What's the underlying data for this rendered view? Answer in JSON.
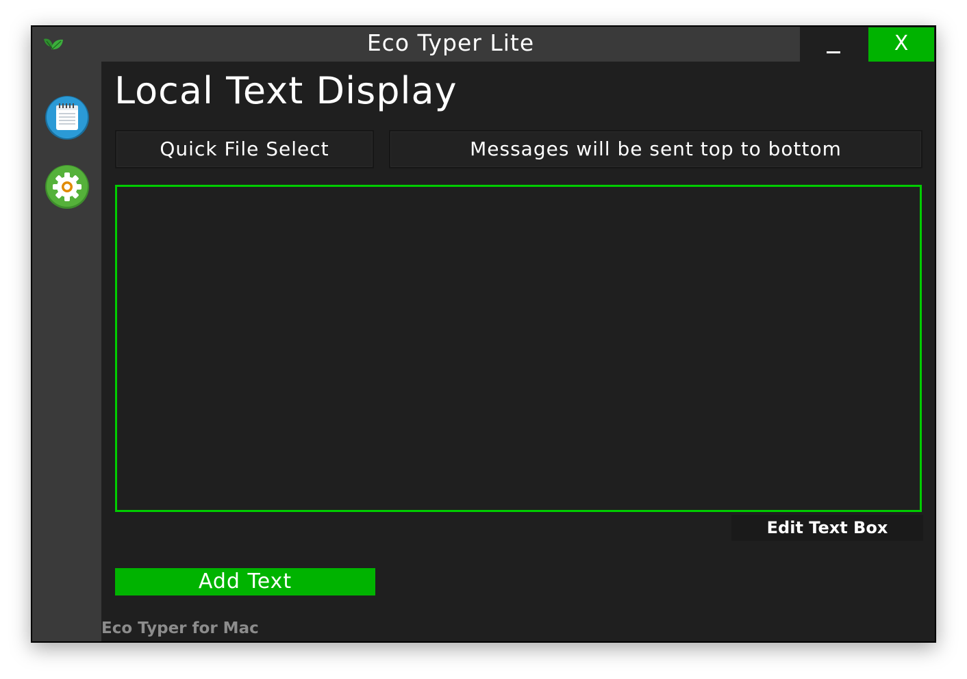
{
  "window": {
    "title": "Eco Typer Lite",
    "close_label": "X",
    "app_icon": "leaf-icon"
  },
  "sidebar": {
    "items": [
      {
        "name": "notepad",
        "icon": "notepad-icon"
      },
      {
        "name": "settings",
        "icon": "gear-icon"
      }
    ]
  },
  "main": {
    "heading": "Local Text Display",
    "quick_file_select_label": "Quick File Select",
    "order_message": "Messages will be sent top to bottom",
    "textbox_value": "",
    "edit_text_box_label": "Edit Text Box",
    "add_text_label": "Add Text"
  },
  "footer": {
    "text": "Eco Typer for Mac"
  },
  "colors": {
    "accent_green": "#00b300",
    "textbox_border": "#00cc00",
    "background": "#1f1f1f",
    "sidebar": "#3a3a3a"
  }
}
